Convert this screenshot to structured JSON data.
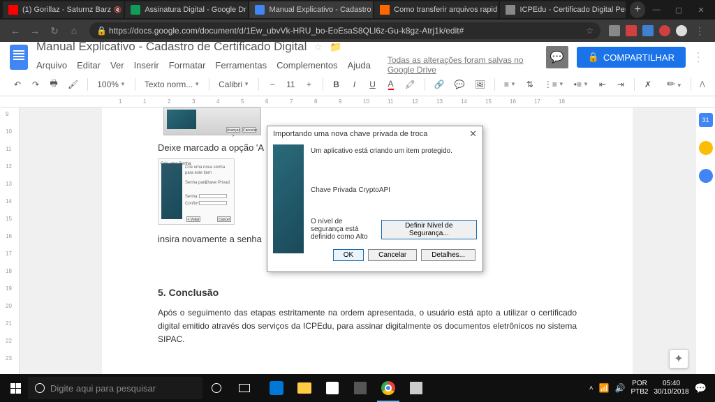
{
  "tabs": [
    {
      "title": "(1) Gorillaz - Saturnz Barz",
      "icon_color": "#ff0000"
    },
    {
      "title": "Assinatura Digital - Google Dr",
      "icon_color": "#0f9d58"
    },
    {
      "title": "Manual Explicativo - Cadastro",
      "icon_color": "#4285f4"
    },
    {
      "title": "Como transferir arquivos rapid",
      "icon_color": "#ff6700"
    },
    {
      "title": "ICPEdu - Certificado Digital Pes",
      "icon_color": "#888"
    }
  ],
  "url": "https://docs.google.com/document/d/1Ew_ubvVk-HRU_bo-EoEsaS8QLl6z-Gu-k8gz-Atrj1k/edit#",
  "doc": {
    "title": "Manual Explicativo - Cadastro de Certificado Digital",
    "menus": [
      "Arquivo",
      "Editar",
      "Ver",
      "Inserir",
      "Formatar",
      "Ferramentas",
      "Complementos",
      "Ajuda"
    ],
    "save_status": "Todas as alterações foram salvas no Google Drive",
    "share": "COMPARTILHAR"
  },
  "toolbar": {
    "zoom": "100%",
    "style": "Texto norm...",
    "font": "Calibri",
    "size": "11"
  },
  "content": {
    "line1": "Deixe marcado a opção 'A",
    "line2": "insira novamente a senha",
    "heading": "5. Conclusão",
    "para": "Após o seguimento das etapas estritamente na ordem apresentada, o usuário está apto a utilizar o certificado digital emitido através dos serviços da ICPEdu, para assinar digitalmente os documentos eletrônicos no sistema SIPAC.",
    "mini": {
      "crie": "Crie uma Senha",
      "crie2": "Crie uma nova senha para este item",
      "senha": "Senha para",
      "chave": "Chave Privad",
      "senha2": "Senha:",
      "confirmar": "Confirmar:",
      "voltar": "< Voltar",
      "cancelar": "Cancel",
      "avancar": "Avançar >",
      "cancelar2": "Cancelar"
    }
  },
  "dialog": {
    "title": "Importando uma nova chave privada de troca",
    "msg1": "Um aplicativo está criando um item protegido.",
    "msg2": "Chave Privada CryptoAPI",
    "msg3": "O nível de segurança está definido como Alto",
    "btn_level": "Definir Nível de Segurança...",
    "ok": "OK",
    "cancel": "Cancelar",
    "details": "Detalhes..."
  },
  "sidebar": {
    "cal": "31"
  },
  "taskbar": {
    "search_placeholder": "Digite aqui para pesquisar",
    "lang1": "POR",
    "lang2": "PTB2",
    "time": "05:40",
    "date": "30/10/2018"
  }
}
